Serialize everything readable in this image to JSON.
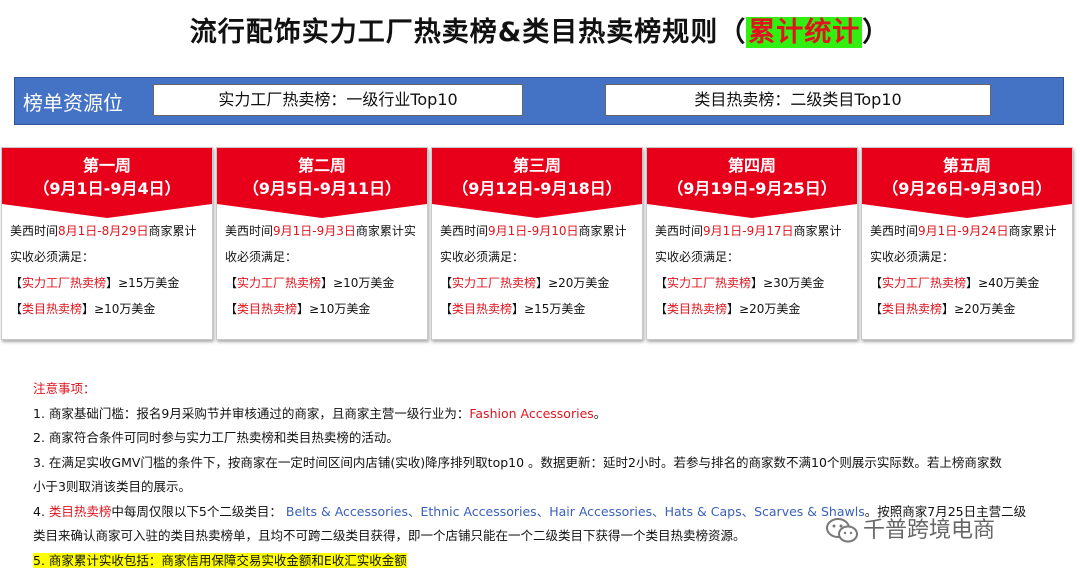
{
  "title": {
    "main": "流行配饰实力工厂热卖榜&类目热卖榜规则（",
    "highlight": "累计统计",
    "end": "）"
  },
  "resource_bar": {
    "label": "榜单资源位",
    "factory_box": "实力工厂热卖榜：一级行业Top10",
    "category_box": "类目热卖榜：二级类目Top10"
  },
  "weeks": [
    {
      "week": "第一周",
      "dates": "（9月1日-9月4日）",
      "pre": "美西时间",
      "range": "8月1日-8月29日",
      "post": "商家累计实收必须满足：",
      "factory_label": "实力工厂热卖榜",
      "factory_req": "≥15万美金",
      "category_label": "类目热卖榜",
      "category_req": "≥10万美金"
    },
    {
      "week": "第二周",
      "dates": "（9月5日-9月11日）",
      "pre": "美西时间",
      "range": "9月1日-9月3日",
      "post": "商家累计实收必须满足：",
      "factory_label": "实力工厂热卖榜",
      "factory_req": "≥10万美金",
      "category_label": "类目热卖榜",
      "category_req": "≥10万美金"
    },
    {
      "week": "第三周",
      "dates": "（9月12日-9月18日）",
      "pre": "美西时间",
      "range": "9月1日-9月10日",
      "post": "商家累计实收必须满足：",
      "factory_label": "实力工厂热卖榜",
      "factory_req": "≥20万美金",
      "category_label": "类目热卖榜",
      "category_req": "≥15万美金"
    },
    {
      "week": "第四周",
      "dates": "（9月19日-9月25日）",
      "pre": "美西时间",
      "range": "9月1日-9月17日",
      "post": "商家累计实收必须满足：",
      "factory_label": "实力工厂热卖榜",
      "factory_req": "≥30万美金",
      "category_label": "类目热卖榜",
      "category_req": "≥20万美金"
    },
    {
      "week": "第五周",
      "dates": "（9月26日-9月30日）",
      "pre": "美西时间",
      "range": "9月1日-9月24日",
      "post": "商家累计实收必须满足：",
      "factory_label": "实力工厂热卖榜",
      "factory_req": "≥40万美金",
      "category_label": "类目热卖榜",
      "category_req": "≥20万美金"
    }
  ],
  "notes": {
    "heading": "注意事项：",
    "n1_pre": "1. 商家基础门槛：报名9月采购节并审核通过的商家，且商家主营一级行业为：",
    "n1_red": "Fashion Accessories",
    "n1_post": "。",
    "n2": "2. 商家符合条件可同时参与实力工厂热卖榜和类目热卖榜的活动。",
    "n3_a": "3. 在满足实收GMV门槛的条件下，按商家在一定时间区间内店铺(实收)降序排列取top10 。数据更新：延时2小时。若参与排名的商家数不满10个则展示实际数。若上榜商家数",
    "n3_b": "小于3则取消该类目的展示。",
    "n4_pre": "4. ",
    "n4_red": "类目热卖榜",
    "n4_mid": "中每周仅限以下5个二级类目：",
    "n4_cats": "Belts & Accessories、Ethnic Accessories、Hair Accessories、Hats & Caps、Scarves & Shawls",
    "n4_post": "。按照商家7月25日主营二级",
    "n4_b": "类目来确认商家可入驻的类目热卖榜单，且均不可跨二级类目获得，即一个店铺只能在一个二级类目下获得一个类目热卖榜资源。",
    "n5": "5. 商家累计实收包括：商家信用保障交易实收金额和E收汇实收金额"
  },
  "watermark": {
    "text": "千普跨境电商",
    "icon": "wechat-icon"
  },
  "colors": {
    "accent_red": "#e8001b",
    "bar_blue": "#4472c4",
    "highlight_green": "#33ee11",
    "note_yellow": "#ffff00",
    "link_blue": "#3a60b8"
  }
}
